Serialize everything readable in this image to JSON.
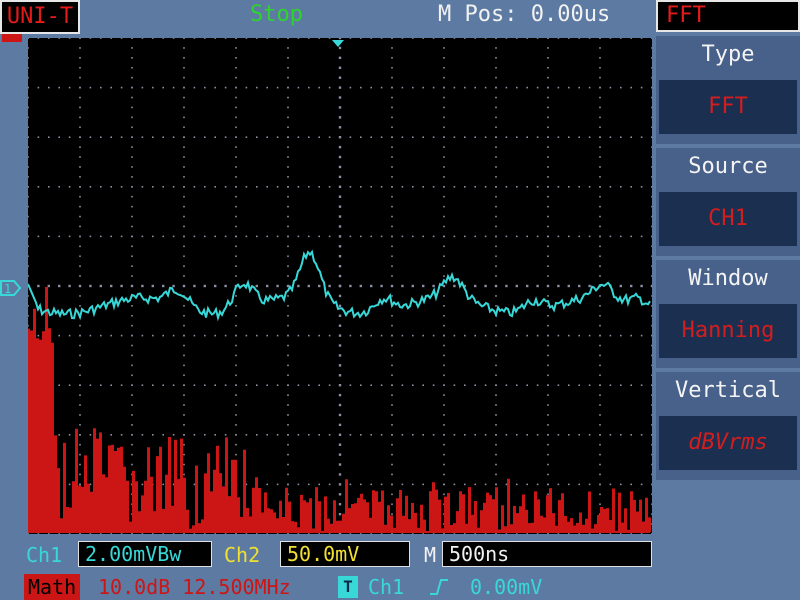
{
  "header": {
    "brand": "UNI-T",
    "status": "Stop",
    "main_position": "M Pos: 0.00us"
  },
  "menu": {
    "title": "FFT",
    "items": [
      {
        "label": "Type",
        "value": "FFT"
      },
      {
        "label": "Source",
        "value": "CH1"
      },
      {
        "label": "Window",
        "value": "Hanning"
      },
      {
        "label": "Vertical",
        "value": "dBVrms"
      }
    ]
  },
  "footer": {
    "ch1_label": "Ch1",
    "ch1_scale": "2.00mVBw",
    "ch2_label": "Ch2",
    "ch2_scale": "50.0mV",
    "time_label": "M",
    "time_scale": "500ns",
    "math_label": "Math",
    "math_info": "10.0dB 12.500MHz",
    "trigger_icon": "T",
    "trigger_source": "Ch1",
    "trigger_edge": "rising-edge-icon",
    "trigger_level": "0.00mV"
  },
  "channel_marker": "1",
  "colors": {
    "ch1": "#38d8d8",
    "math": "#cc1515",
    "ch2": "#f0e030",
    "status": "#2fd32f",
    "brand": "#e51b1b"
  }
}
